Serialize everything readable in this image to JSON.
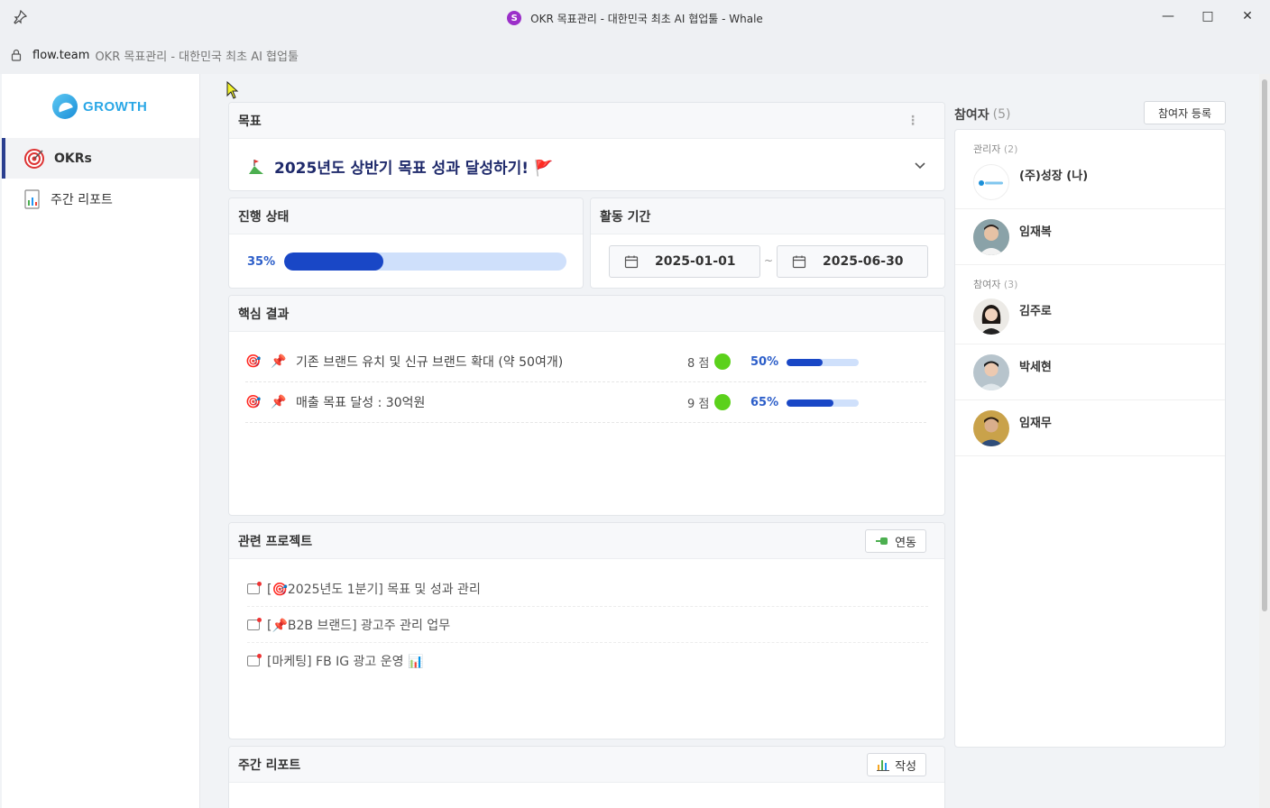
{
  "window": {
    "title": "OKR 목표관리 - 대한민국 최초 AI 협업툴 - Whale"
  },
  "address": {
    "domain": "flow.team",
    "path": "OKR 목표관리 - 대한민국 최초 AI 협업툴"
  },
  "sidebar": {
    "logo": "GROWTH",
    "items": [
      {
        "label": "OKRs",
        "icon": "target-icon",
        "active": true
      },
      {
        "label": "주간 리포트",
        "icon": "report-icon",
        "active": false
      }
    ]
  },
  "goal": {
    "section_title": "목표",
    "text": "2025년도 상반기 목표 성과 달성하기! 🚩"
  },
  "progress": {
    "section_title": "진행 상태",
    "percent_label": "35%",
    "value": 0.35
  },
  "period": {
    "section_title": "활동 기간",
    "start": "2025-01-01",
    "separator": "~",
    "end": "2025-06-30"
  },
  "key_results": {
    "section_title": "핵심 결과",
    "items": [
      {
        "text": "기존 브랜드 유치 및 신규 브랜드 확대 (약 50여개)",
        "score": "8 점",
        "percent_label": "50%",
        "value": 0.5
      },
      {
        "text": "매출 목표 달성 : 30억원",
        "score": "9 점",
        "percent_label": "65%",
        "value": 0.65
      }
    ]
  },
  "projects": {
    "section_title": "관련 프로젝트",
    "button": "연동",
    "items": [
      "[🎯2025년도 1분기] 목표 및 성과 관리",
      "[📌B2B 브랜드] 광고주 관리 업무",
      "[마케팅] FB IG 광고 운영 📊"
    ]
  },
  "weekly": {
    "section_title": "주간 리포트",
    "button": "작성"
  },
  "participants": {
    "title": "참여자",
    "count": "(5)",
    "register_button": "참여자 등록",
    "admin_label": "관리자",
    "admin_count": "(2)",
    "member_label": "참여자",
    "member_count": "(3)",
    "admins": [
      "(주)성장 (나)",
      "임재복"
    ],
    "members": [
      "김주로",
      "박세현",
      "임재무"
    ]
  },
  "colors": {
    "accent": "#1947c6",
    "bar_bg": "#cfe0fb",
    "score_dot": "#5bd11b",
    "nav_active": "#2b3f8f"
  }
}
